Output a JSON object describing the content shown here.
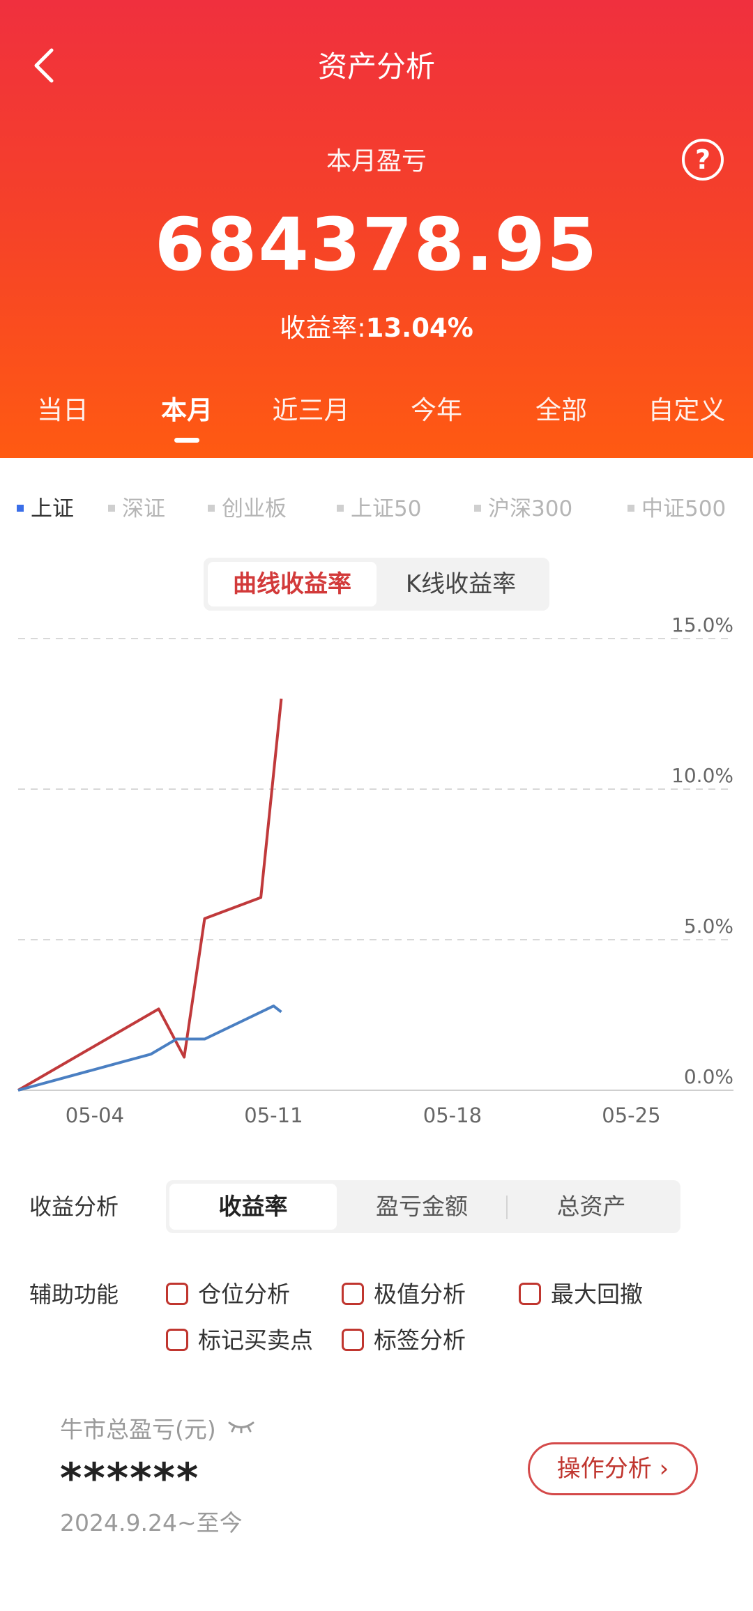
{
  "header": {
    "title": "资产分析",
    "subtitle": "本月盈亏",
    "amount": "684378.95",
    "rate_label": "收益率:",
    "rate_value": "13.04%",
    "help_icon": "?"
  },
  "periods": [
    "当日",
    "本月",
    "近三月",
    "今年",
    "全部",
    "自定义"
  ],
  "active_period": "本月",
  "benchmarks": [
    "上证",
    "深证",
    "创业板",
    "上证50",
    "沪深300",
    "中证500"
  ],
  "active_benchmark": "上证",
  "chart_mode": {
    "options": [
      "曲线收益率",
      "K线收益率"
    ],
    "active": "曲线收益率"
  },
  "chart_data": {
    "type": "line",
    "x_labels": [
      "05-04",
      "05-11",
      "05-18",
      "05-25"
    ],
    "y_ticks": [
      "15.0%",
      "10.0%",
      "5.0%",
      "0.0%"
    ],
    "ylim": [
      0,
      15
    ],
    "xlim_days": [
      1,
      29
    ],
    "series": [
      {
        "color": "#c0393b",
        "points": [
          [
            1,
            0
          ],
          [
            6.5,
            2.7
          ],
          [
            7.5,
            1.1
          ],
          [
            8.3,
            5.7
          ],
          [
            10.5,
            6.4
          ],
          [
            11.3,
            13.0
          ]
        ]
      },
      {
        "color": "#4a7fc2",
        "points": [
          [
            1,
            0
          ],
          [
            6.2,
            1.2
          ],
          [
            7.2,
            1.7
          ],
          [
            8.3,
            1.7
          ],
          [
            11.0,
            2.8
          ],
          [
            11.3,
            2.6
          ]
        ]
      }
    ],
    "grid": true
  },
  "analysis": {
    "label": "收益分析",
    "options": [
      "收益率",
      "盈亏金额",
      "总资产"
    ],
    "active": "收益率"
  },
  "aux": {
    "label": "辅助功能",
    "options": [
      "仓位分析",
      "极值分析",
      "最大回撤",
      "标记买卖点",
      "标签分析"
    ]
  },
  "bull": {
    "title": "牛市总盈亏(元)",
    "value": "******",
    "date": "2024.9.24~至今",
    "button": "操作分析 ›",
    "eye_icon": "eye-closed-icon"
  },
  "colors": {
    "accent": "#f0303e",
    "orange": "#ff5a12",
    "benchmark_blue": "#3a6ee8",
    "return_red": "#c0393b"
  }
}
